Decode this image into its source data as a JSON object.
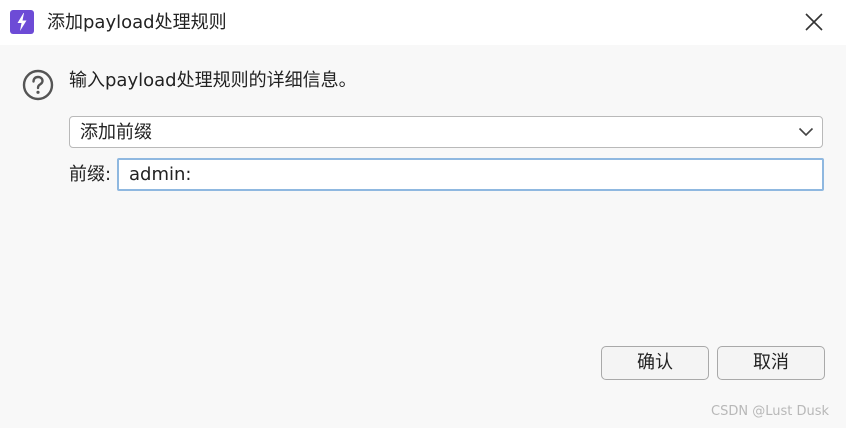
{
  "window": {
    "title": "添加payload处理规则",
    "app_icon": "lightning-bolt-icon",
    "close_icon": "close-icon"
  },
  "dialog": {
    "prompt_icon": "question-circle-icon",
    "prompt": "输入payload处理规则的详细信息。",
    "rule_type": {
      "selected": "添加前缀",
      "icon": "chevron-down-icon"
    },
    "prefix_field": {
      "label": "前缀:",
      "value": "admin:"
    }
  },
  "buttons": {
    "ok": "确认",
    "cancel": "取消"
  },
  "watermark": "CSDN @Lust Dusk",
  "colors": {
    "accent": "#6d4bd6",
    "input_focus_border": "#8fb8e0"
  }
}
